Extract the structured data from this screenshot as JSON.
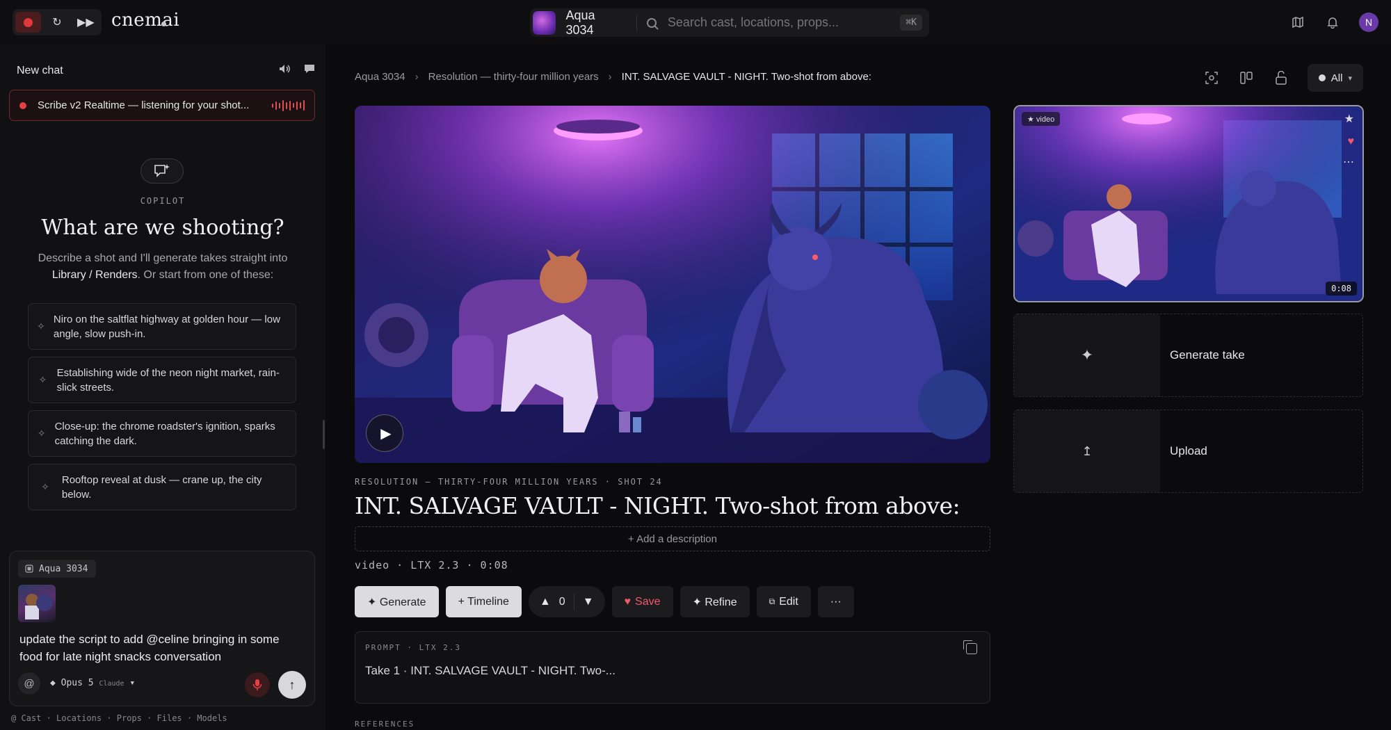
{
  "topbar": {
    "brand": "cnemai",
    "project_name": "Aqua 3034",
    "search_placeholder": "Search cast, locations, props...",
    "search_shortcut": "⌘K",
    "user_initial": "N"
  },
  "sidebar": {
    "new_chat": "New chat",
    "listening": "Scribe v2 Realtime — listening for your shot...",
    "copilot_label": "COPILOT",
    "copilot_title": "What are we shooting?",
    "copilot_desc_1": "Describe a shot and I'll generate takes straight into ",
    "copilot_desc_link": "Library / Renders",
    "copilot_desc_2": ". Or start from one of these:",
    "suggestions": [
      "Niro on the saltflat highway at golden hour — low angle, slow push-in.",
      "Establishing wide of the neon night market, rain-slick streets.",
      "Close-up: the chrome roadster's ignition, sparks catching the dark.",
      "Rooftop reveal at dusk — crane up, the city below."
    ],
    "composer": {
      "tag": "Aqua 3034",
      "text": "update the script to add @celine bringing in some food for late night snacks conversation",
      "model": "Opus 5",
      "model_vendor": "Claude"
    },
    "footer": "@ Cast · Locations · Props · Files · Models"
  },
  "breadcrumb": {
    "project": "Aqua 3034",
    "sequence": "Resolution — thirty-four million years",
    "shot": "INT. SALVAGE VAULT - NIGHT. Two-shot from above:"
  },
  "filter": {
    "label": "All"
  },
  "shot": {
    "meta": "RESOLUTION — THIRTY-FOUR MILLION YEARS · SHOT 24",
    "title": "INT. SALVAGE VAULT - NIGHT. Two-shot from above:",
    "add_description": "+ Add a description",
    "spec": "video · LTX 2.3 · 0:08"
  },
  "actions": {
    "generate": "✦ Generate",
    "timeline": "+ Timeline",
    "votes": "0",
    "save": "Save",
    "refine": "✦ Refine",
    "edit": "Edit",
    "more": "···"
  },
  "prompt": {
    "label": "PROMPT · LTX 2.3",
    "text": "Take 1 · INT. SALVAGE VAULT - NIGHT. Two-..."
  },
  "references_label": "REFERENCES",
  "take": {
    "badge": "★ video",
    "duration": "0:08"
  },
  "cards": {
    "generate_take": "Generate take",
    "upload": "Upload"
  },
  "colors": {
    "accent_red": "#e0383c",
    "heart": "#ef5a6a",
    "avatar": "#6a3aa8"
  }
}
